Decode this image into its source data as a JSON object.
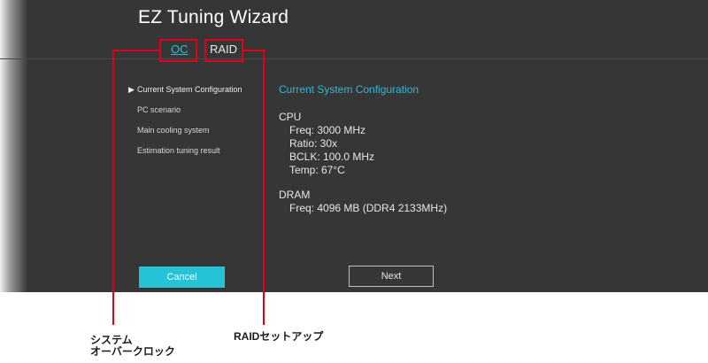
{
  "window": {
    "title": "EZ Tuning Wizard"
  },
  "tabs": [
    {
      "label": "OC",
      "active": true
    },
    {
      "label": "RAID",
      "active": false
    }
  ],
  "steps": [
    {
      "label": "Current System Configuration",
      "active": true
    },
    {
      "label": "PC scenario",
      "active": false
    },
    {
      "label": "Main cooling system",
      "active": false
    },
    {
      "label": "Estimation tuning result",
      "active": false
    }
  ],
  "main": {
    "section_title": "Current System Configuration",
    "cpu": {
      "heading": "CPU",
      "freq": "Freq: 3000 MHz",
      "ratio": "Ratio: 30x",
      "bclk": "BCLK: 100.0 MHz",
      "temp": "Temp: 67°C"
    },
    "dram": {
      "heading": "DRAM",
      "freq": "Freq: 4096 MB (DDR4 2133MHz)"
    }
  },
  "buttons": {
    "cancel": "Cancel",
    "next": "Next"
  },
  "annotations": {
    "oc_line1": "システム",
    "oc_line2": "オーバークロック",
    "raid": "RAIDセットアップ"
  },
  "colors": {
    "accent": "#2fb9d6",
    "highlight": "#e0001a",
    "panel": "#363636"
  },
  "icons": {
    "active_step": "triangle-right-icon"
  }
}
